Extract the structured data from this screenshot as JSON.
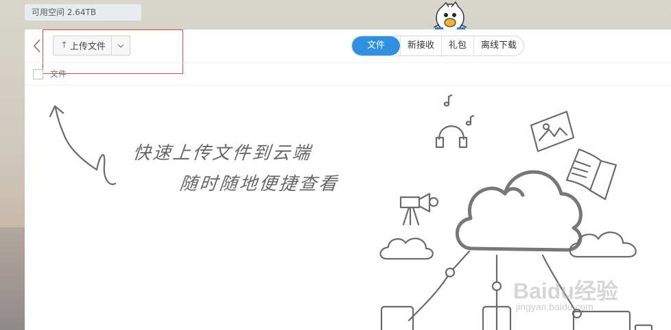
{
  "header": {
    "space_label": "可用空间 2.64TB"
  },
  "toolbar": {
    "upload_label": "上传文件",
    "tabs": [
      {
        "label": "文件",
        "active": true
      },
      {
        "label": "新接收",
        "active": false
      },
      {
        "label": "礼包",
        "active": false
      },
      {
        "label": "离线下载",
        "active": false
      }
    ]
  },
  "list": {
    "column_label": "文件"
  },
  "empty_state": {
    "line1": "快速上传文件到云端",
    "line2": "随时随地便捷查看"
  },
  "watermark": {
    "brand": "Baidu经验",
    "url": "jingyan.baidu.com"
  },
  "colors": {
    "accent": "#2f8fe0",
    "highlight": "#d94a4a"
  },
  "icons": [
    "back-arrow-icon",
    "upload-arrow-icon",
    "chevron-down-icon",
    "cloud-icon",
    "mascot-icon"
  ]
}
